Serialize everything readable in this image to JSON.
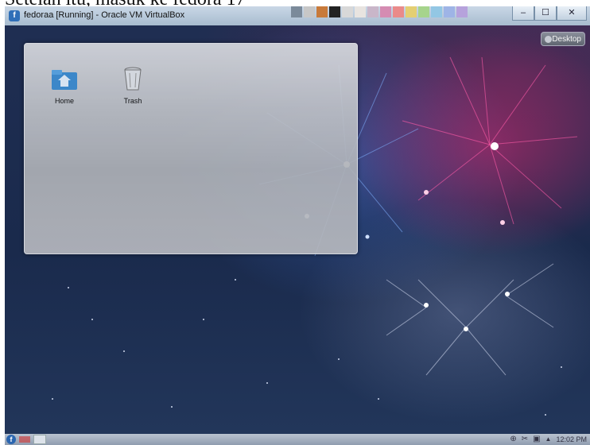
{
  "caption": "Setelah itu, masuk ke fedora 17",
  "window": {
    "title": "fedoraa [Running] - Oracle VM VirtualBox",
    "minimize_icon": "minimize-icon",
    "maximize_icon": "maximize-icon",
    "close_icon": "close-icon"
  },
  "desktop": {
    "toolbox_label": "Desktop",
    "items": [
      {
        "label": "Home",
        "icon": "home-folder-icon"
      },
      {
        "label": "Trash",
        "icon": "trash-icon"
      }
    ]
  },
  "taskbar": {
    "launcher_icon": "fedora-launcher-icon",
    "clock": "12:02 PM"
  }
}
